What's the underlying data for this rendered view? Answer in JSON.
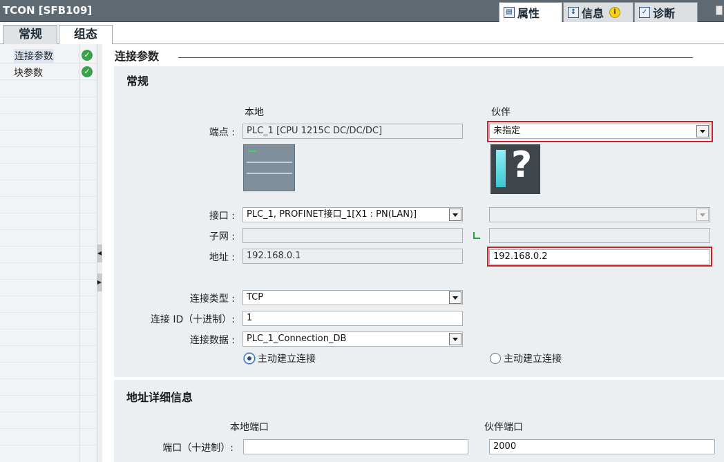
{
  "window": {
    "title": "TCON [SFB109]"
  },
  "top_tabs": [
    {
      "label": "属性",
      "icon": "properties-icon"
    },
    {
      "label": "信息",
      "icon": "info-icon"
    },
    {
      "label": "诊断",
      "icon": "diagnostics-icon"
    }
  ],
  "sub_tabs": [
    {
      "label": "常规"
    },
    {
      "label": "组态"
    }
  ],
  "nav": {
    "items": [
      {
        "label": "连接参数",
        "status": "ok"
      },
      {
        "label": "块参数",
        "status": "ok"
      }
    ]
  },
  "main": {
    "section_title": "连接参数",
    "general": {
      "title": "常规",
      "col_local": "本地",
      "col_partner": "伙伴",
      "endpoint_label": "端点 :",
      "local_endpoint": "PLC_1 [CPU 1215C DC/DC/DC]",
      "partner_endpoint": "未指定",
      "interface_label": "接口 :",
      "local_interface": "PLC_1, PROFINET接口_1[X1 : PN(LAN)]",
      "partner_interface": "",
      "subnet_label": "子网 :",
      "local_subnet": "",
      "partner_subnet": "",
      "address_label": "地址 :",
      "local_address": "192.168.0.1",
      "partner_address": "192.168.0.2",
      "conn_type_label": "连接类型 :",
      "conn_type": "TCP",
      "conn_id_label": "连接 ID（十进制）:",
      "conn_id": "1",
      "conn_data_label": "连接数据 :",
      "conn_data": "PLC_1_Connection_DB",
      "radio_local_label": "主动建立连接",
      "radio_partner_label": "主动建立连接",
      "radio_local_checked": true
    },
    "address_details": {
      "title": "地址详细信息",
      "local_port_header": "本地端口",
      "partner_port_header": "伙伴端口",
      "port_label": "端口（十进制）:",
      "local_port": "",
      "partner_port": "2000"
    }
  },
  "colors": {
    "titlebar": "#5e6972",
    "highlight_border": "#d21f26",
    "panel_bg": "#eceff1",
    "status_ok": "#3aa24a"
  }
}
